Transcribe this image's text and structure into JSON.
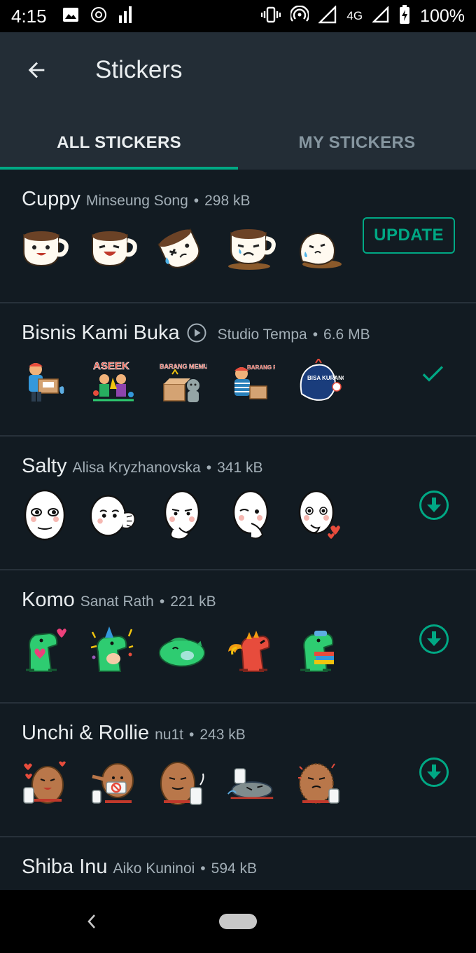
{
  "status_bar": {
    "time": "4:15",
    "network": "4G",
    "battery": "100%",
    "icons": [
      "image-icon",
      "at-icon",
      "signal-bars-icon",
      "vibrate-icon",
      "hotspot-icon",
      "data-icon",
      "cell-signal-icon",
      "battery-icon"
    ]
  },
  "app_bar": {
    "title": "Stickers",
    "back_icon": "arrow-left-icon"
  },
  "tabs": [
    {
      "label": "ALL STICKERS",
      "active": true
    },
    {
      "label": "MY STICKERS",
      "active": false
    }
  ],
  "packs": [
    {
      "name": "Cuppy",
      "author": "Minseung Song",
      "size": "298 kB",
      "action": "update",
      "action_label": "UPDATE"
    },
    {
      "name": "Bisnis Kami Buka",
      "author": "Studio Tempa",
      "size": "6.6 MB",
      "action": "installed",
      "animated": true
    },
    {
      "name": "Salty",
      "author": "Alisa Kryzhanovska",
      "size": "341 kB",
      "action": "download"
    },
    {
      "name": "Komo",
      "author": "Sanat Rath",
      "size": "221 kB",
      "action": "download"
    },
    {
      "name": "Unchi & Rollie",
      "author": "nu1t",
      "size": "243 kB",
      "action": "download"
    },
    {
      "name": "Shiba Inu",
      "author": "Aiko Kuninoi",
      "size": "594 kB",
      "action": "download"
    }
  ],
  "sticker_text": {
    "bisnis_2": "ASEEK",
    "bisnis_3": "BARANG MEMUASKAN",
    "bisnis_4": "BARANG READY KAK",
    "bisnis_5": "BISA KURANG GAK?"
  },
  "colors": {
    "accent": "#00a884",
    "app_bar": "#232d36",
    "background": "#121b22"
  }
}
